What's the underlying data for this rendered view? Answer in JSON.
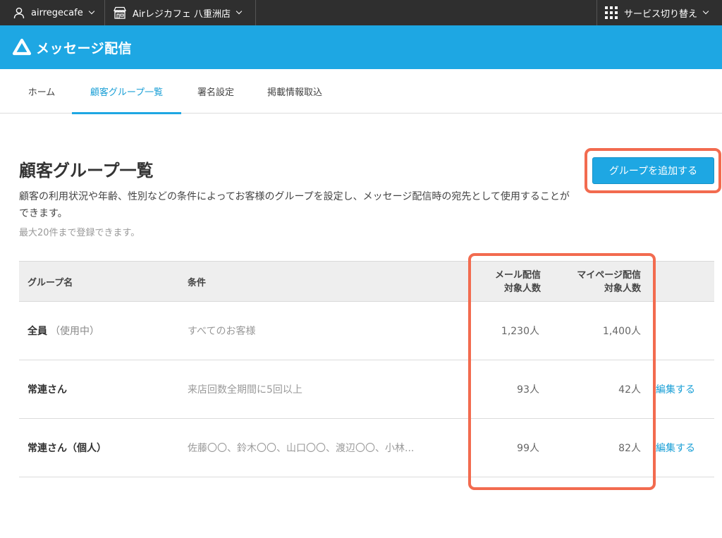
{
  "topbar": {
    "account_name": "airregecafe",
    "store_name": "Airレジカフェ 八重洲店",
    "service_switch": "サービス切り替え"
  },
  "header": {
    "app_title": "メッセージ配信"
  },
  "tabs": [
    {
      "label": "ホーム"
    },
    {
      "label": "顧客グループ一覧"
    },
    {
      "label": "署名設定"
    },
    {
      "label": "掲載情報取込"
    }
  ],
  "main": {
    "title": "顧客グループ一覧",
    "description": "顧客の利用状況や年齢、性別などの条件によってお客様のグループを設定し、メッセージ配信時の宛先として使用することができます。",
    "note": "最大20件まで登録できます。",
    "add_button": "グループを追加する"
  },
  "table": {
    "headers": {
      "name": "グループ名",
      "condition": "条件",
      "mail_line1": "メール配信",
      "mail_line2": "対象人数",
      "mypage_line1": "マイページ配信",
      "mypage_line2": "対象人数"
    },
    "rows": [
      {
        "name": "全員",
        "sub": "（使用中）",
        "condition": "すべてのお客様",
        "mail": "1,230人",
        "mypage": "1,400人",
        "edit": ""
      },
      {
        "name": "常連さん",
        "sub": "",
        "condition": "来店回数全期間に5回以上",
        "mail": "93人",
        "mypage": "42人",
        "edit": "編集する"
      },
      {
        "name": "常連さん（個人）",
        "sub": "",
        "condition": "佐藤〇〇、鈴木〇〇、山口〇〇、渡辺〇〇、小林...",
        "mail": "99人",
        "mypage": "82人",
        "edit": "編集する"
      }
    ]
  },
  "colors": {
    "topbar": "#2f2f2f",
    "brand": "#1ea7e3",
    "highlight": "#f26b4f",
    "link": "#1a9fd6"
  }
}
